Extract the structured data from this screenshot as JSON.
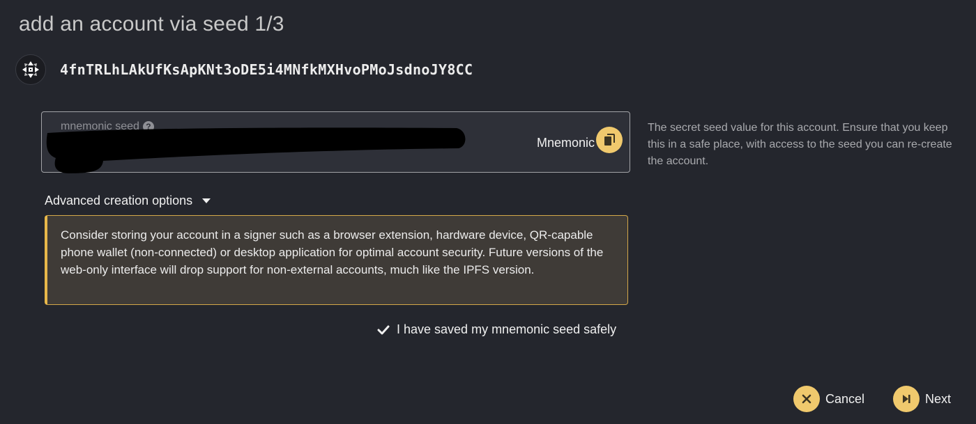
{
  "modal": {
    "title": "add an account via seed 1/3"
  },
  "account": {
    "identicon": "identicon-icon",
    "address": "4fnTRLhLAkUfKsApKNt3oDE5i4MNfkMXHvoPMoJsdnoJY8CC"
  },
  "seed_field": {
    "label": "mnemonic seed",
    "help_icon": "question-circle-icon",
    "value": "",
    "redacted": true,
    "type_label": "Mnemonic",
    "copy_icon": "copy-icon"
  },
  "help": {
    "text": "The secret seed value for this account. Ensure that you keep this in a safe place, with access to the seed you can re-create the account."
  },
  "advanced": {
    "label": "Advanced creation options",
    "icon": "caret-down-icon"
  },
  "warning": {
    "text": "Consider storing your account in a signer such as a browser extension, hardware device, QR-capable phone wallet (non-connected) or desktop application for optimal account security. Future versions of the web-only interface will drop support for non-external accounts, much like the IPFS version."
  },
  "confirm": {
    "label": "I have saved my mnemonic seed safely",
    "checked": true
  },
  "actions": {
    "cancel_label": "Cancel",
    "cancel_icon": "close-icon",
    "next_label": "Next",
    "next_icon": "step-forward-icon"
  },
  "colors": {
    "background": "#24262d",
    "accent": "#f0c96d",
    "warning_border": "#e8b84a",
    "warning_background": "#3f3b37"
  }
}
